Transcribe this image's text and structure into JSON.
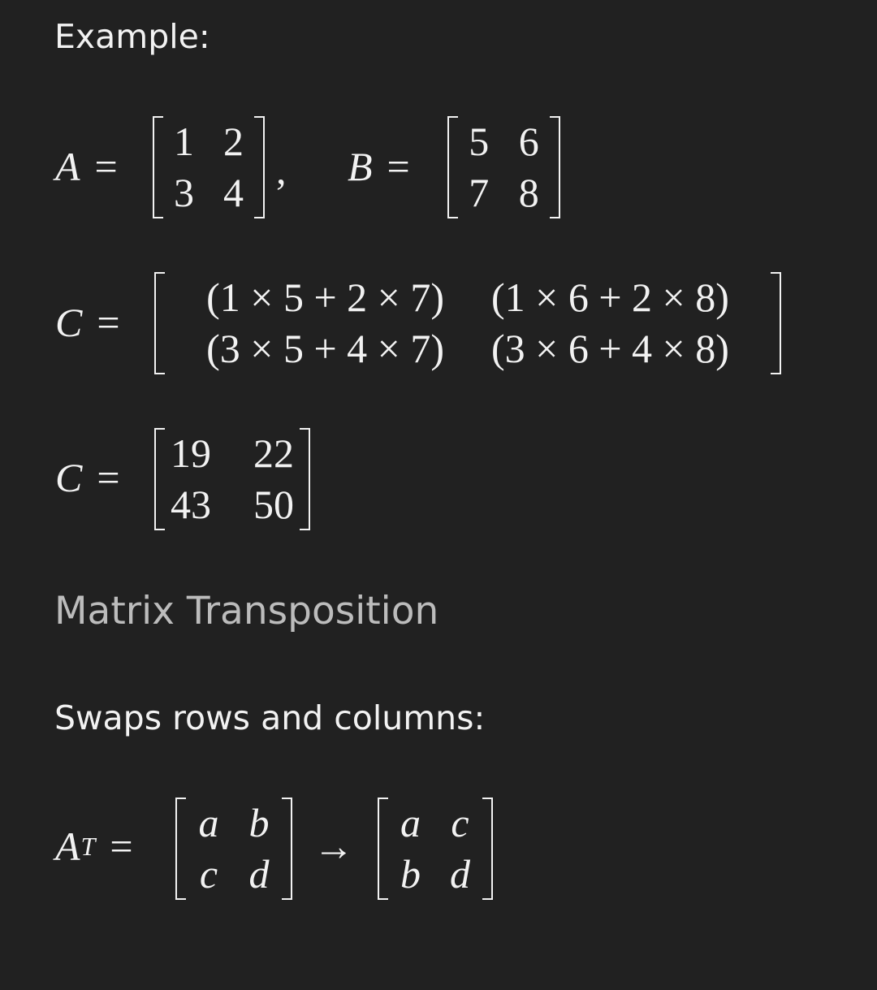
{
  "intro": "Example:",
  "eq1": {
    "a_name": "A",
    "equals": "=",
    "a_matrix": [
      [
        "1",
        "2"
      ],
      [
        "3",
        "4"
      ]
    ],
    "separator": ",",
    "b_name": "B",
    "b_matrix": [
      [
        "5",
        "6"
      ],
      [
        "7",
        "8"
      ]
    ]
  },
  "eq2": {
    "c_name": "C",
    "equals": "=",
    "matrix": [
      [
        "(1 × 5 + 2 × 7)",
        "(1 × 6 + 2 × 8)"
      ],
      [
        "(3 × 5 + 4 × 7)",
        "(3 × 6 + 4 × 8)"
      ]
    ]
  },
  "eq3": {
    "c_name": "C",
    "equals": "=",
    "matrix": [
      [
        "19",
        "22"
      ],
      [
        "43",
        "50"
      ]
    ]
  },
  "heading": "Matrix Transposition",
  "description": "Swaps rows and columns:",
  "eq4": {
    "a_name": "A",
    "superscript": "T",
    "equals": "=",
    "matrix": [
      [
        "a",
        "b"
      ],
      [
        "c",
        "d"
      ]
    ],
    "arrow": "→",
    "result": [
      [
        "a",
        "c"
      ],
      [
        "b",
        "d"
      ]
    ]
  }
}
